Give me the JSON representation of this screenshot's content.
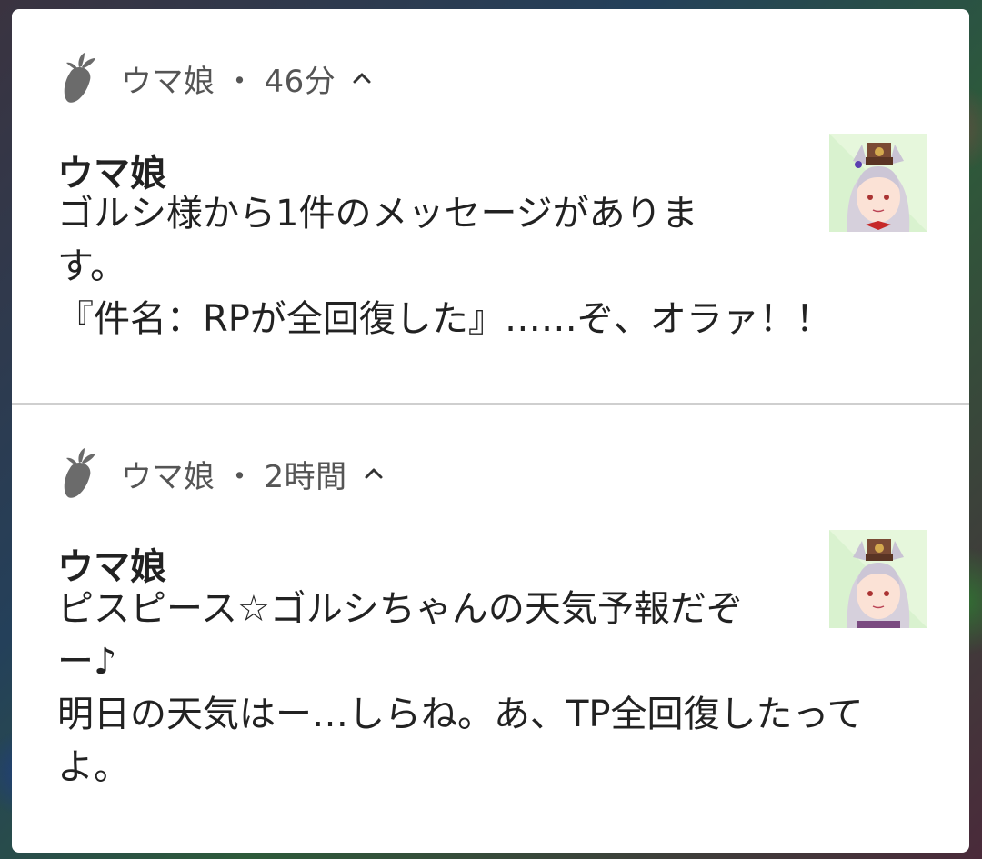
{
  "notifications": [
    {
      "app_name": "ウマ娘",
      "time": "46分",
      "app_icon": "carrot-icon",
      "expand_icon": "chevron-up-icon",
      "title": "ウマ娘",
      "body_lines": [
        "ゴルシ様から1件のメッセージがありま",
        "す。",
        "『件名：RPが全回復した』……ぞ、オラァ！！"
      ],
      "thumbnail": "character-avatar-icon"
    },
    {
      "app_name": "ウマ娘",
      "time": "2時間",
      "app_icon": "carrot-icon",
      "expand_icon": "chevron-up-icon",
      "title": "ウマ娘",
      "body_lines": [
        "ピスピース☆ゴルシちゃんの天気予報だぞ",
        "ー♪",
        "明日の天気はー…しらね。あ、TP全回復したって",
        "よ。"
      ],
      "thumbnail": "character-avatar-icon"
    }
  ],
  "header_separator": "・",
  "colors": {
    "card_bg": "#ffffff",
    "header_text": "#555555",
    "body_text": "#222222",
    "icon_gray": "#6b6b6b"
  }
}
